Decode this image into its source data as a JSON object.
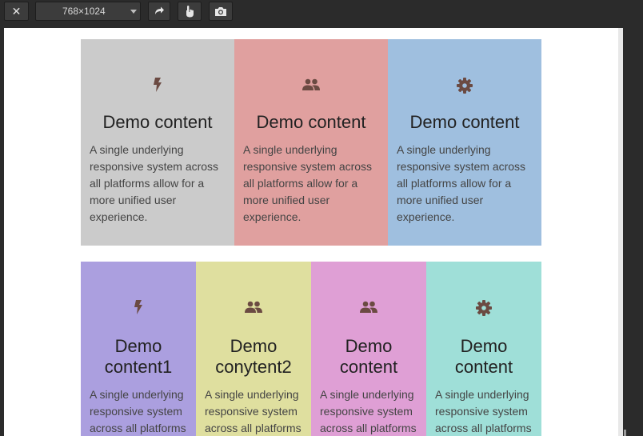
{
  "toolbar": {
    "close_glyph": "✕",
    "device_size": "768×1024",
    "icons": [
      "close-icon",
      "rotate-icon",
      "touch-icon",
      "camera-icon"
    ]
  },
  "colors": {
    "gray": "#cbcbcb",
    "red": "#e0a09f",
    "blue": "#9fbfdf",
    "purple": "#ab9fdf",
    "yellow": "#dfdf9f",
    "pink": "#df9fd5",
    "teal": "#9fdfd8",
    "icon": "#6b4a42"
  },
  "row1": [
    {
      "icon": "bolt-icon",
      "title": "Demo content",
      "text": "A single underlying responsive system across all platforms allow for a more unified user experience."
    },
    {
      "icon": "people-icon",
      "title": "Demo content",
      "text": "A single underlying responsive system across all platforms allow for a more unified user experience."
    },
    {
      "icon": "gear-icon",
      "title": "Demo content",
      "text": "A single underlying responsive system across all platforms allow for a more unified user experience."
    }
  ],
  "row2": [
    {
      "icon": "bolt-icon",
      "title": "Demo content1",
      "text": "A single underlying responsive system across all platforms"
    },
    {
      "icon": "people-icon",
      "title": "Demo conytent2",
      "text": "A single underlying responsive system across all platforms"
    },
    {
      "icon": "people-icon",
      "title": "Demo content",
      "text": "A single underlying responsive system across all platforms"
    },
    {
      "icon": "gear-icon",
      "title": "Demo content",
      "text": "A single underlying responsive system across all platforms"
    }
  ]
}
